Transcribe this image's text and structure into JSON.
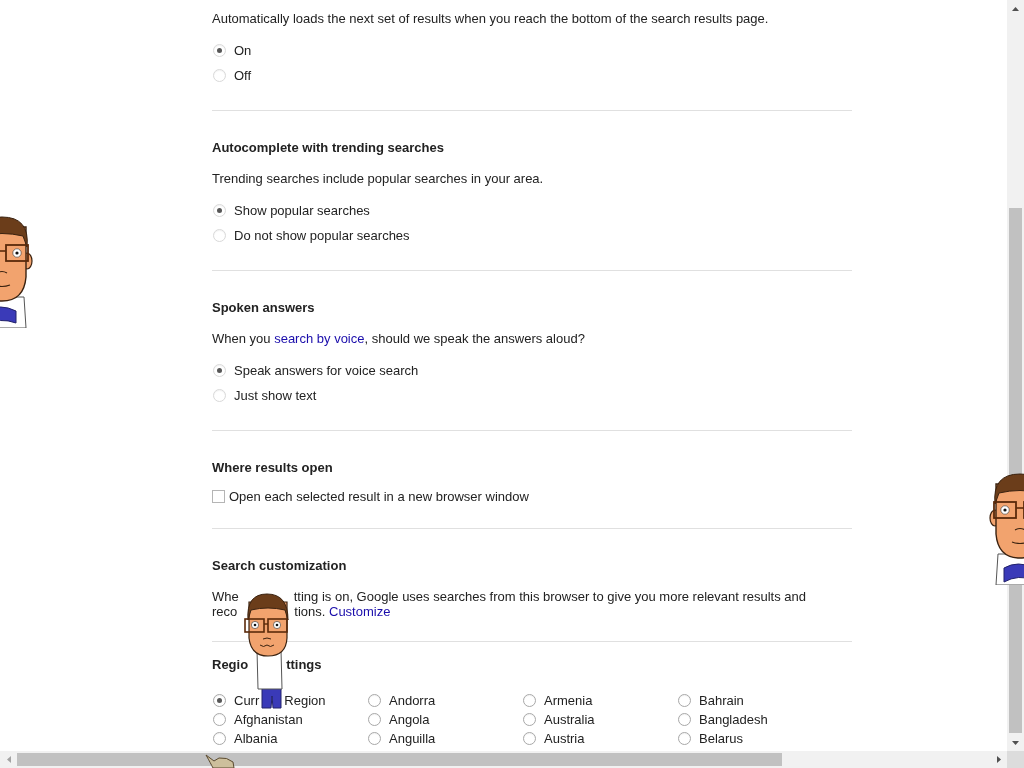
{
  "sections": [
    {
      "kind": "radio",
      "description": [
        {
          "text": "Automatically loads the next set of results when you reach the bottom of the search results page."
        }
      ],
      "options": [
        {
          "label": "On",
          "selected": true
        },
        {
          "label": "Off",
          "selected": false
        }
      ]
    },
    {
      "kind": "radio",
      "heading": "Autocomplete with trending searches",
      "description": [
        {
          "text": "Trending searches include popular searches in your area."
        }
      ],
      "options": [
        {
          "label": "Show popular searches",
          "selected": true
        },
        {
          "label": "Do not show popular searches",
          "selected": false
        }
      ]
    },
    {
      "kind": "radio",
      "heading": "Spoken answers",
      "description": [
        {
          "text": "When you "
        },
        {
          "text": "search by voice",
          "kind": "link"
        },
        {
          "text": ", should we speak the answers aloud?"
        }
      ],
      "options": [
        {
          "label": "Speak answers for voice search",
          "selected": true
        },
        {
          "label": "Just show text",
          "selected": false
        }
      ]
    },
    {
      "kind": "checkbox",
      "heading": "Where results open",
      "options": [
        {
          "label": "Open each selected result in a new browser window",
          "checked": false
        }
      ]
    },
    {
      "kind": "text",
      "heading": "Search customization",
      "lines": [
        {
          "parts": [
            "Whe",
            "tting is on, Google uses searches from this browser to give you more relevant results and"
          ]
        },
        {
          "parts": [
            "reco",
            "tions."
          ],
          "link": "Customize"
        }
      ]
    },
    {
      "kind": "region",
      "heading_parts": [
        "Regio",
        "ttings"
      ],
      "columns": [
        [
          {
            "label_parts": [
              "Curr",
              "Region"
            ],
            "selected": true
          },
          {
            "label_parts": [
              "Afghanistan"
            ],
            "selected": false
          },
          {
            "label_parts": [
              "Albania"
            ],
            "selected": false
          }
        ],
        [
          {
            "label_parts": [
              "Andorra"
            ],
            "selected": false
          },
          {
            "label_parts": [
              "Angola"
            ],
            "selected": false
          },
          {
            "label_parts": [
              "Anguilla"
            ],
            "selected": false
          }
        ],
        [
          {
            "label_parts": [
              "Armenia"
            ],
            "selected": false
          },
          {
            "label_parts": [
              "Australia"
            ],
            "selected": false
          },
          {
            "label_parts": [
              "Austria"
            ],
            "selected": false
          }
        ],
        [
          {
            "label_parts": [
              "Bahrain"
            ],
            "selected": false
          },
          {
            "label_parts": [
              "Bangladesh"
            ],
            "selected": false
          },
          {
            "label_parts": [
              "Belarus"
            ],
            "selected": false
          }
        ]
      ]
    }
  ]
}
